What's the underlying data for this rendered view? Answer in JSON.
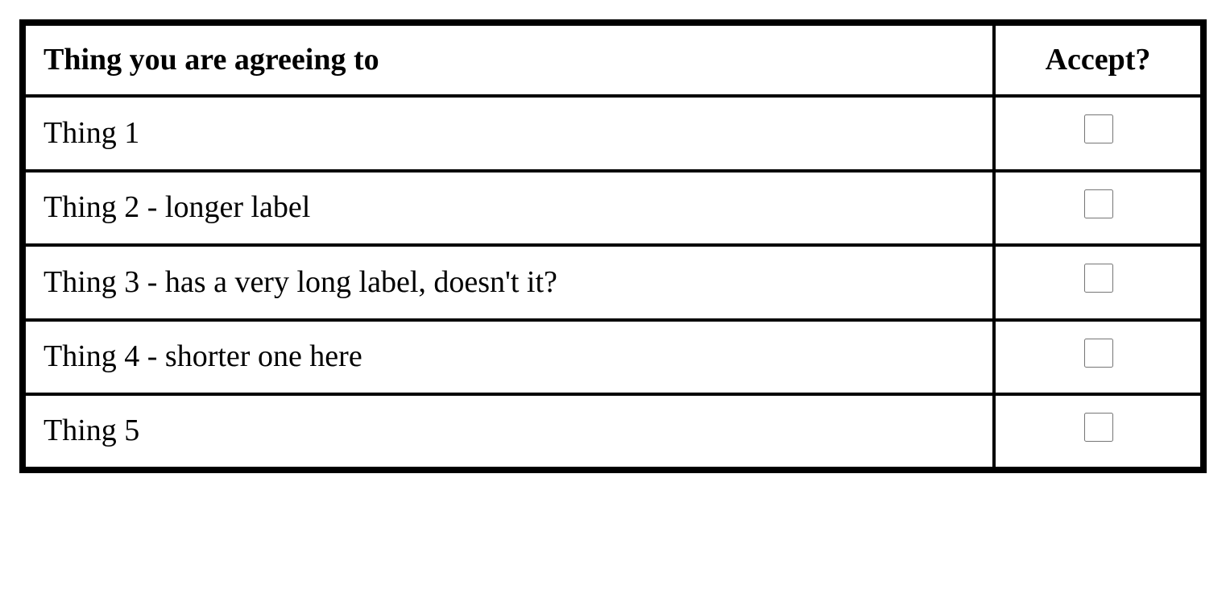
{
  "table": {
    "headers": {
      "thing": "Thing you are agreeing to",
      "accept": "Accept?"
    },
    "rows": [
      {
        "label": "Thing 1",
        "checked": false
      },
      {
        "label": "Thing 2 - longer label",
        "checked": false
      },
      {
        "label": "Thing 3 - has a very long label, doesn't it?",
        "checked": false
      },
      {
        "label": "Thing 4 - shorter one here",
        "checked": false
      },
      {
        "label": "Thing 5",
        "checked": false
      }
    ]
  }
}
